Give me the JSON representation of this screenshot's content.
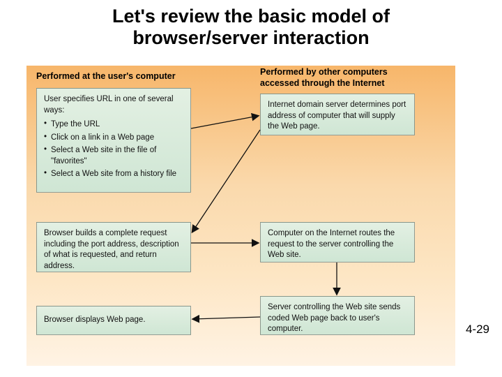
{
  "title_line1": "Let's review the basic model of",
  "title_line2": "browser/server interaction",
  "left_header": "Performed at the user's computer",
  "right_header_l1": "Performed by other computers",
  "right_header_l2": "accessed through the Internet",
  "left": {
    "box1": {
      "lead": "User specifies URL in one of several ways:",
      "items": [
        "Type the URL",
        "Click on a link in a Web page",
        "Select a Web site in the file of \"favorites\"",
        "Select a Web site from a history file"
      ]
    },
    "box2": "Browser builds a complete request including the port address, description of what is requested, and return address.",
    "box3": "Browser displays Web page."
  },
  "right": {
    "box1": "Internet domain server determines port address of computer that will supply the Web page.",
    "box2": "Computer on the Internet routes the request to the server controlling the Web site.",
    "box3": "Server controlling the Web site sends coded Web page back to user's computer."
  },
  "page_number": "4-29"
}
